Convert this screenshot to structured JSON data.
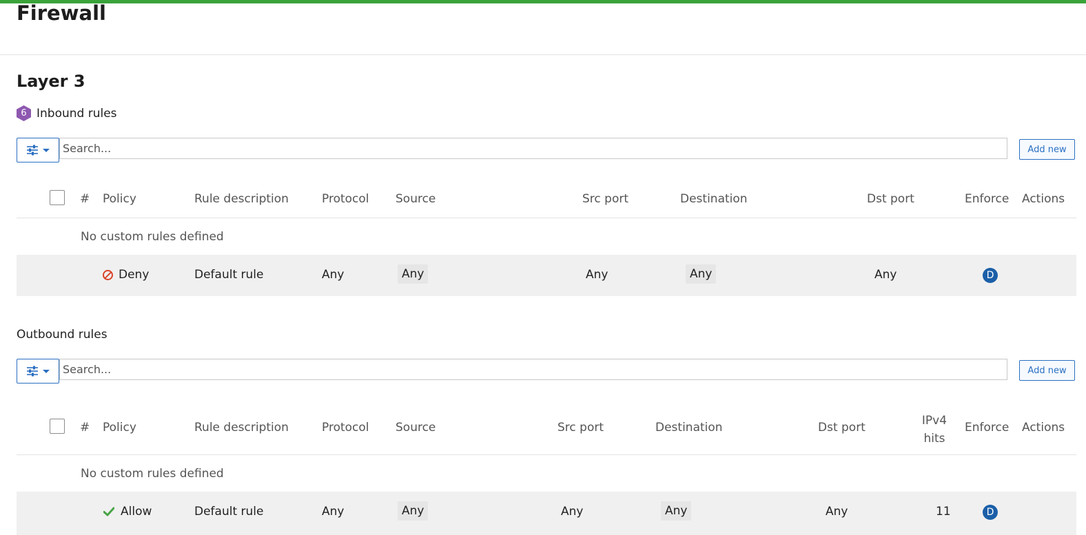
{
  "colors": {
    "accent_bar": "#3aa33a",
    "primary": "#2a6fc2",
    "deny": "#d9442b",
    "allow": "#47a447",
    "badge_purple": "#8e58b0",
    "enforce": "#1b5fa8"
  },
  "page": {
    "title": "Firewall"
  },
  "section": {
    "title": "Layer 3"
  },
  "inbound": {
    "badge": "6",
    "heading": "Inbound rules",
    "search_placeholder": "Search...",
    "add_label": "Add new",
    "columns": {
      "num": "#",
      "policy": "Policy",
      "desc": "Rule description",
      "protocol": "Protocol",
      "source": "Source",
      "src_port": "Src port",
      "destination": "Destination",
      "dst_port": "Dst port",
      "enforce": "Enforce",
      "actions": "Actions"
    },
    "empty_text": "No custom rules defined",
    "default_rule": {
      "policy": "Deny",
      "desc": "Default rule",
      "protocol": "Any",
      "source": "Any",
      "src_port": "Any",
      "destination": "Any",
      "dst_port": "Any",
      "enforce": "D"
    }
  },
  "outbound": {
    "heading": "Outbound rules",
    "search_placeholder": "Search...",
    "add_label": "Add new",
    "columns": {
      "num": "#",
      "policy": "Policy",
      "desc": "Rule description",
      "protocol": "Protocol",
      "source": "Source",
      "src_port": "Src port",
      "destination": "Destination",
      "dst_port": "Dst port",
      "ipv4_hits_line1": "IPv4",
      "ipv4_hits_line2": "hits",
      "enforce": "Enforce",
      "actions": "Actions"
    },
    "empty_text": "No custom rules defined",
    "default_rule": {
      "policy": "Allow",
      "desc": "Default rule",
      "protocol": "Any",
      "source": "Any",
      "src_port": "Any",
      "destination": "Any",
      "dst_port": "Any",
      "ipv4_hits": "11",
      "enforce": "D"
    }
  },
  "icons": {
    "filter": "sliders-icon",
    "caret": "caret-down-icon",
    "deny": "deny-icon",
    "allow": "check-icon"
  }
}
